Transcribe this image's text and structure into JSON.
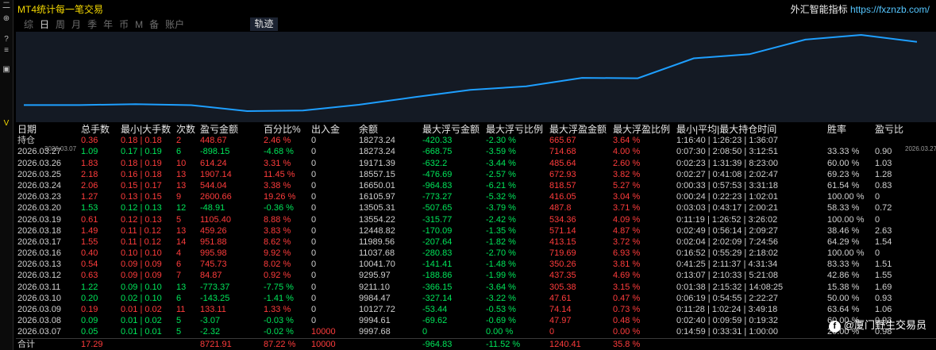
{
  "app_title": "MT4统计每一笔交易",
  "brand_cn": "外汇智能指标",
  "brand_url": "https://fxznzb.com/",
  "tabs": [
    "综",
    "日",
    "周",
    "月",
    "季",
    "年",
    "币",
    "M",
    "备",
    "账户"
  ],
  "active_tab": "日",
  "track_button": "轨迹",
  "chart_data": {
    "type": "line",
    "x": [
      "2026.03.07",
      "2026.03.08",
      "2026.03.09",
      "2026.03.10",
      "2026.03.11",
      "2026.03.12",
      "2026.03.13",
      "2026.03.16",
      "2026.03.17",
      "2026.03.18",
      "2026.03.19",
      "2026.03.20",
      "2026.03.23",
      "2026.03.24",
      "2026.03.25",
      "2026.03.26",
      "2026.03.27"
    ],
    "values": [
      9997.68,
      9994.61,
      10127.72,
      9984.47,
      9211.1,
      9295.97,
      10041.7,
      11037.68,
      11989.56,
      12448.82,
      13554.22,
      13505.31,
      16105.97,
      16650.01,
      18557.15,
      19171.39,
      18273.24
    ],
    "color": "#1e9fff",
    "x_start_label": "2026.03.07",
    "x_end_label": "2026.03.27"
  },
  "columns": [
    "日期",
    "总手数",
    "最小|大手数",
    "次数",
    "盈亏金额",
    "百分比%",
    "出入金",
    "余额",
    "最大浮亏金额",
    "最大浮亏比例",
    "最大浮盈金额",
    "最大浮盈比例",
    "最小|平均|最大持仓时间",
    "胜率",
    "盈亏比"
  ],
  "rows": [
    {
      "date": "持仓",
      "lots": "0.36",
      "minmax": "0.18 | 0.18",
      "count": "2",
      "pnl": "448.67",
      "pct": "2.46 %",
      "io": "0",
      "bal": "18273.24",
      "mdd": "-420.33",
      "mddp": "-2.30 %",
      "mfe": "665.67",
      "mfep": "3.64 %",
      "hold": "1:16:40 | 1:26:23 | 1:36:07",
      "win": "",
      "pf": "",
      "c": "red"
    },
    {
      "date": "2026.03.27",
      "lots": "1.09",
      "minmax": "0.17 | 0.19",
      "count": "6",
      "pnl": "-898.15",
      "pct": "-4.68 %",
      "io": "0",
      "bal": "18273.24",
      "mdd": "-668.75",
      "mddp": "-3.59 %",
      "mfe": "714.68",
      "mfep": "4.00 %",
      "hold": "0:07:30 | 2:08:50 | 3:12:51",
      "win": "33.33 %",
      "pf": "0.90",
      "c": "green"
    },
    {
      "date": "2026.03.26",
      "lots": "1.83",
      "minmax": "0.18 | 0.19",
      "count": "10",
      "pnl": "614.24",
      "pct": "3.31 %",
      "io": "0",
      "bal": "19171.39",
      "mdd": "-632.2",
      "mddp": "-3.44 %",
      "mfe": "485.64",
      "mfep": "2.60 %",
      "hold": "0:02:23 | 1:31:39 | 8:23:00",
      "win": "60.00 %",
      "pf": "1.03",
      "c": "red"
    },
    {
      "date": "2026.03.25",
      "lots": "2.18",
      "minmax": "0.16 | 0.18",
      "count": "13",
      "pnl": "1907.14",
      "pct": "11.45 %",
      "io": "0",
      "bal": "18557.15",
      "mdd": "-476.69",
      "mddp": "-2.57 %",
      "mfe": "672.93",
      "mfep": "3.82 %",
      "hold": "0:02:27 | 0:41:08 | 2:02:47",
      "win": "69.23 %",
      "pf": "1.28",
      "c": "red"
    },
    {
      "date": "2026.03.24",
      "lots": "2.06",
      "minmax": "0.15 | 0.17",
      "count": "13",
      "pnl": "544.04",
      "pct": "3.38 %",
      "io": "0",
      "bal": "16650.01",
      "mdd": "-964.83",
      "mddp": "-6.21 %",
      "mfe": "818.57",
      "mfep": "5.27 %",
      "hold": "0:00:33 | 0:57:53 | 3:31:18",
      "win": "61.54 %",
      "pf": "0.83",
      "c": "red"
    },
    {
      "date": "2026.03.23",
      "lots": "1.27",
      "minmax": "0.13 | 0.15",
      "count": "9",
      "pnl": "2600.66",
      "pct": "19.26 %",
      "io": "0",
      "bal": "16105.97",
      "mdd": "-773.27",
      "mddp": "-5.32 %",
      "mfe": "416.05",
      "mfep": "3.04 %",
      "hold": "0:00:24 | 0:22:23 | 1:02:01",
      "win": "100.00 %",
      "pf": "0",
      "c": "red"
    },
    {
      "date": "2026.03.20",
      "lots": "1.53",
      "minmax": "0.12 | 0.13",
      "count": "12",
      "pnl": "-48.91",
      "pct": "-0.36 %",
      "io": "0",
      "bal": "13505.31",
      "mdd": "-507.65",
      "mddp": "-3.79 %",
      "mfe": "487.8",
      "mfep": "3.71 %",
      "hold": "0:03:03 | 0:43:17 | 2:00:21",
      "win": "58.33 %",
      "pf": "0.72",
      "c": "green"
    },
    {
      "date": "2026.03.19",
      "lots": "0.61",
      "minmax": "0.12 | 0.13",
      "count": "5",
      "pnl": "1105.40",
      "pct": "8.88 %",
      "io": "0",
      "bal": "13554.22",
      "mdd": "-315.77",
      "mddp": "-2.42 %",
      "mfe": "534.36",
      "mfep": "4.09 %",
      "hold": "0:11:19 | 1:26:52 | 3:26:02",
      "win": "100.00 %",
      "pf": "0",
      "c": "red"
    },
    {
      "date": "2026.03.18",
      "lots": "1.49",
      "minmax": "0.11 | 0.12",
      "count": "13",
      "pnl": "459.26",
      "pct": "3.83 %",
      "io": "0",
      "bal": "12448.82",
      "mdd": "-170.09",
      "mddp": "-1.35 %",
      "mfe": "571.14",
      "mfep": "4.87 %",
      "hold": "0:02:49 | 0:56:14 | 2:09:27",
      "win": "38.46 %",
      "pf": "2.63",
      "c": "red"
    },
    {
      "date": "2026.03.17",
      "lots": "1.55",
      "minmax": "0.11 | 0.12",
      "count": "14",
      "pnl": "951.88",
      "pct": "8.62 %",
      "io": "0",
      "bal": "11989.56",
      "mdd": "-207.64",
      "mddp": "-1.82 %",
      "mfe": "413.15",
      "mfep": "3.72 %",
      "hold": "0:02:04 | 2:02:09 | 7:24:56",
      "win": "64.29 %",
      "pf": "1.54",
      "c": "red"
    },
    {
      "date": "2026.03.16",
      "lots": "0.40",
      "minmax": "0.10 | 0.10",
      "count": "4",
      "pnl": "995.98",
      "pct": "9.92 %",
      "io": "0",
      "bal": "11037.68",
      "mdd": "-280.83",
      "mddp": "-2.70 %",
      "mfe": "719.69",
      "mfep": "6.93 %",
      "hold": "0:16:52 | 0:55:29 | 2:18:02",
      "win": "100.00 %",
      "pf": "0",
      "c": "red"
    },
    {
      "date": "2026.03.13",
      "lots": "0.54",
      "minmax": "0.09 | 0.09",
      "count": "6",
      "pnl": "745.73",
      "pct": "8.02 %",
      "io": "0",
      "bal": "10041.70",
      "mdd": "-141.41",
      "mddp": "-1.48 %",
      "mfe": "350.26",
      "mfep": "3.81 %",
      "hold": "0:41:25 | 2:11:37 | 4:31:34",
      "win": "83.33 %",
      "pf": "1.51",
      "c": "red"
    },
    {
      "date": "2026.03.12",
      "lots": "0.63",
      "minmax": "0.09 | 0.09",
      "count": "7",
      "pnl": "84.87",
      "pct": "0.92 %",
      "io": "0",
      "bal": "9295.97",
      "mdd": "-188.86",
      "mddp": "-1.99 %",
      "mfe": "437.35",
      "mfep": "4.69 %",
      "hold": "0:13:07 | 2:10:33 | 5:21:08",
      "win": "42.86 %",
      "pf": "1.55",
      "c": "red"
    },
    {
      "date": "2026.03.11",
      "lots": "1.22",
      "minmax": "0.09 | 0.10",
      "count": "13",
      "pnl": "-773.37",
      "pct": "-7.75 %",
      "io": "0",
      "bal": "9211.10",
      "mdd": "-366.15",
      "mddp": "-3.64 %",
      "mfe": "305.38",
      "mfep": "3.15 %",
      "hold": "0:01:38 | 2:15:32 | 14:08:25",
      "win": "15.38 %",
      "pf": "1.69",
      "c": "green"
    },
    {
      "date": "2026.03.10",
      "lots": "0.20",
      "minmax": "0.02 | 0.10",
      "count": "6",
      "pnl": "-143.25",
      "pct": "-1.41 %",
      "io": "0",
      "bal": "9984.47",
      "mdd": "-327.14",
      "mddp": "-3.22 %",
      "mfe": "47.61",
      "mfep": "0.47 %",
      "hold": "0:06:19 | 0:54:55 | 2:22:27",
      "win": "50.00 %",
      "pf": "0.93",
      "c": "green"
    },
    {
      "date": "2026.03.09",
      "lots": "0.19",
      "minmax": "0.01 | 0.02",
      "count": "11",
      "pnl": "133.11",
      "pct": "1.33 %",
      "io": "0",
      "bal": "10127.72",
      "mdd": "-53.44",
      "mddp": "-0.53 %",
      "mfe": "74.14",
      "mfep": "0.73 %",
      "hold": "0:11:28 | 1:02:24 | 3:49:18",
      "win": "63.64 %",
      "pf": "1.06",
      "c": "red"
    },
    {
      "date": "2026.03.08",
      "lots": "0.09",
      "minmax": "0.01 | 0.02",
      "count": "5",
      "pnl": "-3.07",
      "pct": "-0.03 %",
      "io": "0",
      "bal": "9994.61",
      "mdd": "-69.62",
      "mddp": "-0.69 %",
      "mfe": "47.97",
      "mfep": "0.48 %",
      "hold": "0:02:40 | 0:09:59 | 0:19:32",
      "win": "60.00 %",
      "pf": "0.93",
      "c": "green"
    },
    {
      "date": "2026.03.07",
      "lots": "0.05",
      "minmax": "0.01 | 0.01",
      "count": "5",
      "pnl": "-2.32",
      "pct": "-0.02 %",
      "io": "10000",
      "bal": "9997.68",
      "mdd": "0",
      "mddp": "0.00 %",
      "mfe": "0",
      "mfep": "0.00 %",
      "hold": "0:14:59 | 0:33:31 | 1:00:00",
      "win": "20.00 %",
      "pf": "0.98",
      "c": "green"
    }
  ],
  "total": {
    "date": "合计",
    "lots": "17.29",
    "pnl": "8721.91",
    "pct": "87.22 %",
    "io": "10000",
    "mdd": "-964.83",
    "mddp": "-11.52 %",
    "mfe": "1240.41",
    "mfep": "35.8 %"
  },
  "watermark": "@厦门野生交易员",
  "watermark_icon": "facebook-icon",
  "colors": {
    "profit": "#ff3c3c",
    "loss": "#00e65a",
    "title": "#f4d800",
    "url": "#55c6ff",
    "line": "#1e9fff"
  }
}
